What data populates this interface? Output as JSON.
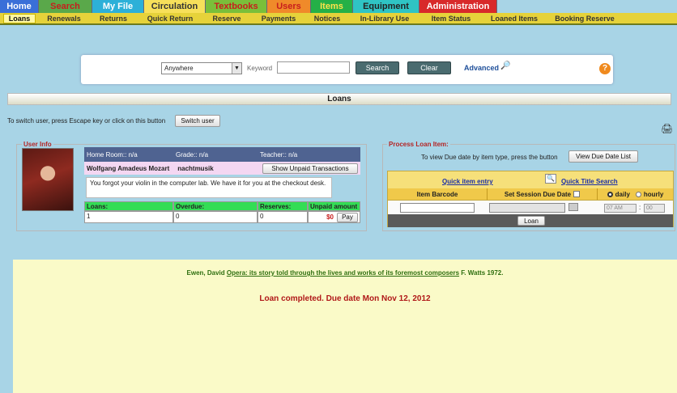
{
  "top_nav": [
    {
      "label": "Home",
      "bg": "#3a6fd8",
      "fg": "#ffffff"
    },
    {
      "label": "Search",
      "bg": "#5aa84a",
      "fg": "#c81d1d"
    },
    {
      "label": "My File",
      "bg": "#2cb0d8",
      "fg": "#ffffff"
    },
    {
      "label": "Circulation",
      "bg": "#f7e05a",
      "fg": "#333333"
    },
    {
      "label": "Textbooks",
      "bg": "#7abf3a",
      "fg": "#c81d1d"
    },
    {
      "label": "Users",
      "bg": "#f08a2a",
      "fg": "#c81d1d"
    },
    {
      "label": "Items",
      "bg": "#25b047",
      "fg": "#ffe24a"
    },
    {
      "label": "Equipment",
      "bg": "#2fc4c4",
      "fg": "#222222"
    },
    {
      "label": "Administration",
      "bg": "#d8292a",
      "fg": "#ffffff"
    }
  ],
  "sub_nav": [
    "Loans",
    "Renewals",
    "Returns",
    "Quick Return",
    "Reserve",
    "Payments",
    "Notices",
    "In-Library Use",
    "Item Status",
    "Loaned Items",
    "Booking Reserve"
  ],
  "search": {
    "scope": "Anywhere",
    "keyword_label": "Keyword",
    "keyword_value": "",
    "search_label": "Search",
    "clear_label": "Clear",
    "advanced_label": "Advanced",
    "help": "?"
  },
  "page_title": "Loans",
  "switch_user": {
    "text": "To switch user, press Escape key or click on this button",
    "button": "Switch user"
  },
  "user_info": {
    "legend": "User Info",
    "home_room": "Home Room:: n/a",
    "grade": "Grade:: n/a",
    "teacher": "Teacher:: n/a",
    "name": "Wolfgang Amadeus Mozart",
    "username": "nachtmusik",
    "unpaid_button": "Show Unpaid Transactions",
    "note": "You forgot your violin in the computer lab. We have it for you at the checkout desk.",
    "columns": [
      "Loans:",
      "Overdue:",
      "Reserves:",
      "Unpaid amount"
    ],
    "values": [
      "1",
      "0",
      "0"
    ],
    "unpaid_amount": "$0",
    "pay_button": "Pay"
  },
  "process_loan": {
    "legend": "Process Loan Item:",
    "tip": "To view Due date by item type, press the button",
    "due_date_button": "View Due Date List",
    "quick_item_entry": "Quick item entry",
    "quick_title_search": "Quick Title Search",
    "col_barcode": "Item Barcode",
    "col_session_due": "Set Session Due Date",
    "daily": "daily",
    "hourly": "hourly",
    "hour": "07 AM",
    "minute": "00",
    "loan_button": "Loan"
  },
  "result": {
    "author": "Ewen, David",
    "title": "Opera: its story told through the lives and works of its foremost composers",
    "publisher": "F. Watts 1972.",
    "message": "Loan completed. Due date Mon Nov 12, 2012"
  }
}
